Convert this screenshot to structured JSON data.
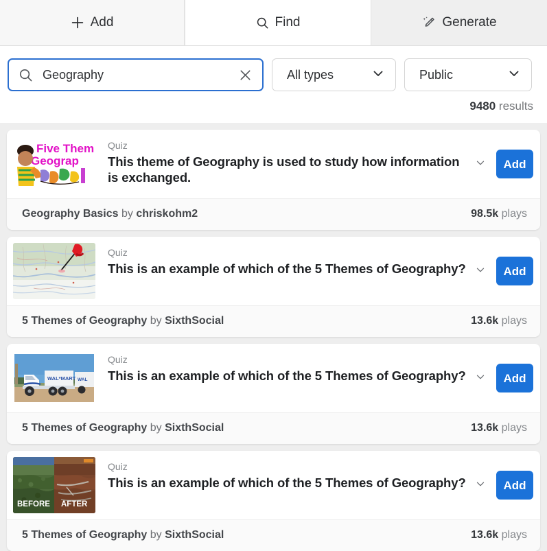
{
  "tabs": [
    {
      "id": "add",
      "label": "Add",
      "icon": "plus-icon",
      "active": false
    },
    {
      "id": "find",
      "label": "Find",
      "icon": "search-icon",
      "active": true
    },
    {
      "id": "generate",
      "label": "Generate",
      "icon": "magic-wand-icon",
      "active": false
    }
  ],
  "search": {
    "value": "Geography",
    "placeholder": "Search",
    "icon": "search-icon",
    "clear_icon": "close-icon"
  },
  "filters": {
    "type": {
      "value": "All types",
      "icon": "chevron-down-icon"
    },
    "visibility": {
      "value": "Public",
      "icon": "chevron-down-icon"
    }
  },
  "results_summary": {
    "count": "9480",
    "label": "results"
  },
  "colors": {
    "accent": "#1b72d9",
    "focus_border": "#2b6fd0",
    "page_background": "#eeeeee",
    "card_background": "#ffffff",
    "footer_background": "#fafafa"
  },
  "results": [
    {
      "kind": "Quiz",
      "title": "This theme of Geography is used to study how information is exchanged.",
      "thumbnail": "five-themes-of-geography-cartoon",
      "expand_icon": "chevron-down-icon",
      "add_label": "Add",
      "set_name": "Geography Basics",
      "by": "by",
      "author": "chriskohm2",
      "plays_count": "98.5k",
      "plays_label": "plays"
    },
    {
      "kind": "Quiz",
      "title": "This is an example of which of the 5 Themes of Geography?",
      "thumbnail": "map-with-red-pushpin",
      "expand_icon": "chevron-down-icon",
      "add_label": "Add",
      "set_name": "5 Themes of Geography",
      "by": "by",
      "author": "SixthSocial",
      "plays_count": "13.6k",
      "plays_label": "plays"
    },
    {
      "kind": "Quiz",
      "title": "This is an example of which of the 5 Themes of Geography?",
      "thumbnail": "walmart-semi-truck",
      "expand_icon": "chevron-down-icon",
      "add_label": "Add",
      "set_name": "5 Themes of Geography",
      "by": "by",
      "author": "SixthSocial",
      "plays_count": "13.6k",
      "plays_label": "plays"
    },
    {
      "kind": "Quiz",
      "title": "This is an example of which of the 5 Themes of Geography?",
      "thumbnail": "deforestation-before-after",
      "thumbnail_labels": [
        "BEFORE",
        "AFTER"
      ],
      "expand_icon": "chevron-down-icon",
      "add_label": "Add",
      "set_name": "5 Themes of Geography",
      "by": "by",
      "author": "SixthSocial",
      "plays_count": "13.6k",
      "plays_label": "plays"
    }
  ]
}
